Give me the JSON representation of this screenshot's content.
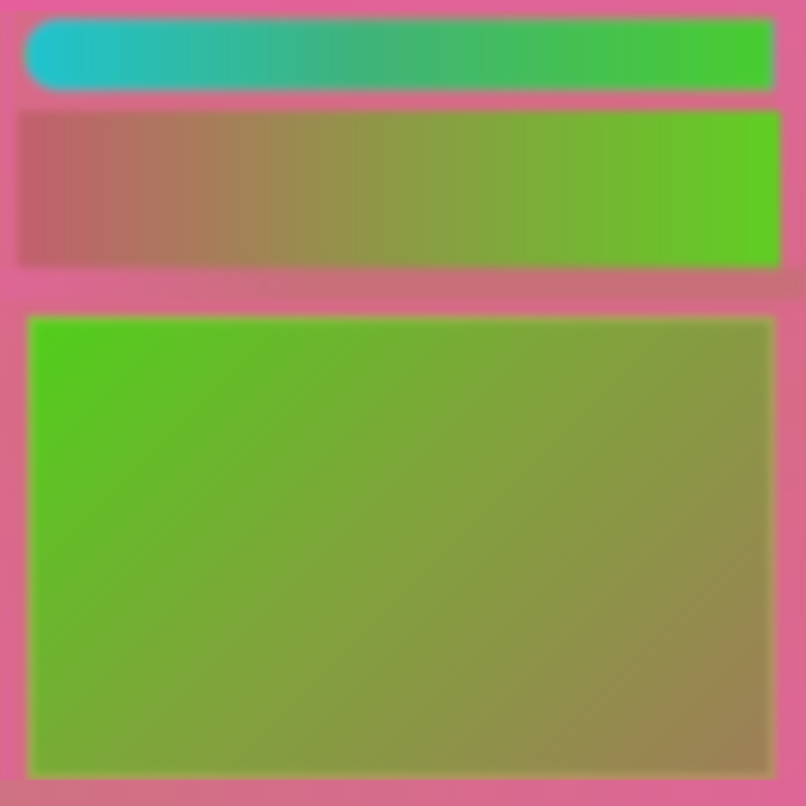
{
  "colors": {
    "background": "#d86a88",
    "top_strip": "#e5609a",
    "address_bar_left": "#1fc3cf",
    "address_bar_mid": "#3fb37a",
    "address_bar_right": "#48cc2e",
    "header_left": "#c35f6e",
    "header_mid": "#8c9a45",
    "header_right": "#5fcf22",
    "separator": "#c86f7a",
    "content_top_left": "#4fcf1a",
    "content_mid": "#7ea53a",
    "content_right": "#9f7d58",
    "content_bottom_left": "#49d510",
    "edge_pink": "#de6696",
    "bottom_strip": "#cf7282"
  },
  "regions": {
    "address_bar": "",
    "header": "",
    "content": ""
  }
}
